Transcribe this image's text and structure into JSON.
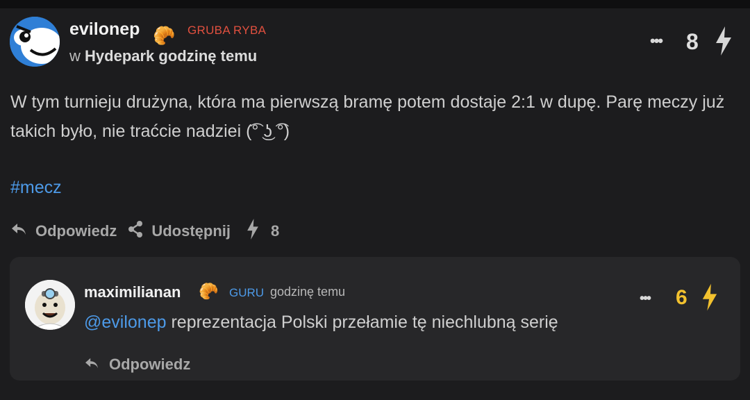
{
  "post": {
    "author": "evilonep",
    "rank_badge": "GRUBA RYBA",
    "meta_prefix": "w",
    "community": "Hydepark",
    "time": "godzinę temu",
    "score": "8",
    "content": "W tym turnieju drużyna, która ma pierwszą bramę potem dostaje 2:1 w dupę. Parę meczy już takich było, nie traćcie nadziei (͡° ͜ʖ ͡°)",
    "hashtag": "#mecz",
    "actions": {
      "reply": "Odpowiedz",
      "share": "Udostępnij",
      "vote_count": "8"
    }
  },
  "reply": {
    "author": "maximilianan",
    "rank_badge": "GURU",
    "time": "godzinę temu",
    "score": "6",
    "mention": "@evilonep",
    "content": " reprezentacja Polski przełamie tę niechlubną serię",
    "actions": {
      "reply": "Odpowiedz"
    }
  },
  "icons": {
    "more": "more-dots-icon",
    "bolt": "lightning-icon",
    "reply": "reply-arrow-icon",
    "share": "share-icon",
    "rank": "croissant-icon"
  },
  "colors": {
    "background": "#1c1c1e",
    "reply_background": "#272729",
    "accent_blue": "#4d9ae8",
    "badge_red": "#e0503f",
    "bolt_active": "#f2c12e"
  }
}
